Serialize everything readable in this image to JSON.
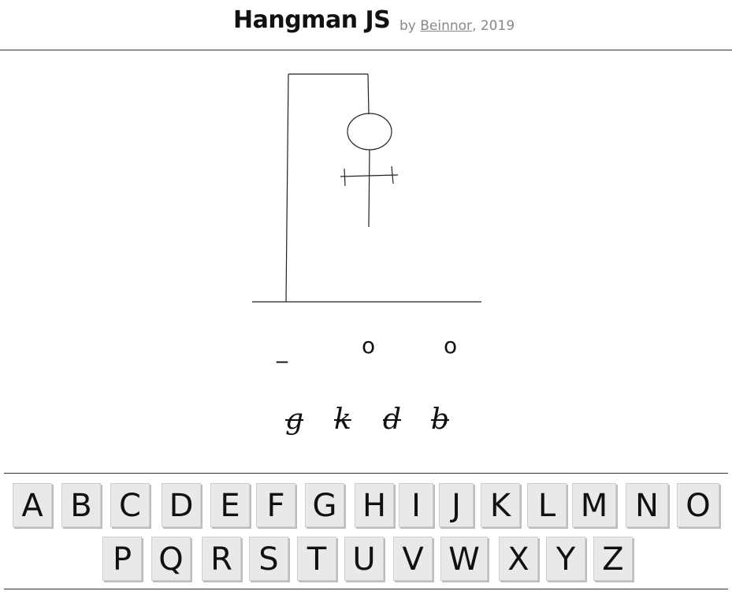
{
  "header": {
    "title": "Hangman JS",
    "by_prefix": "by ",
    "author": "Beinnor",
    "year_suffix": ", 2019"
  },
  "word": {
    "slots": [
      "_",
      "o",
      "o"
    ]
  },
  "wrong_guesses": [
    "g",
    "k",
    "d",
    "b"
  ],
  "keyboard": {
    "row1": [
      "A",
      "B",
      "C",
      "D",
      "E",
      "F",
      "G",
      "H",
      "I",
      "J",
      "K",
      "L",
      "M",
      "N",
      "O"
    ],
    "row2": [
      "P",
      "Q",
      "R",
      "S",
      "T",
      "U",
      "V",
      "W",
      "X",
      "Y",
      "Z"
    ]
  },
  "hangman": {
    "parts_drawn": [
      "head",
      "body",
      "arms"
    ]
  }
}
